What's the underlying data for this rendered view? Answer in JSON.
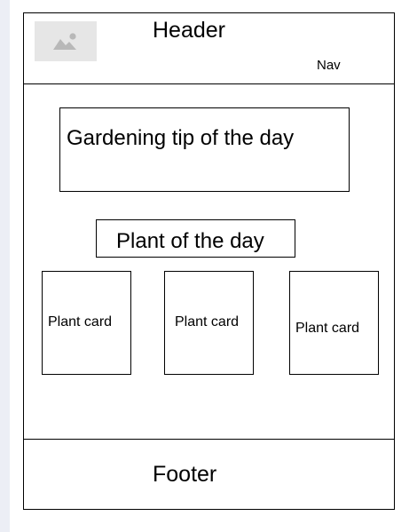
{
  "header": {
    "title": "Header",
    "nav_label": "Nav",
    "logo_icon": "image-placeholder-icon"
  },
  "main": {
    "tip_title": "Gardening tip of the day",
    "plant_of_day_title": "Plant of the day",
    "plant_cards": [
      "Plant card",
      "Plant card",
      "Plant card"
    ]
  },
  "footer": {
    "label": "Footer"
  },
  "colors": {
    "border": "#000000",
    "placeholder_bg": "#e6e6e6",
    "placeholder_icon": "#b8b8b8",
    "left_strip": "#eceef5"
  }
}
